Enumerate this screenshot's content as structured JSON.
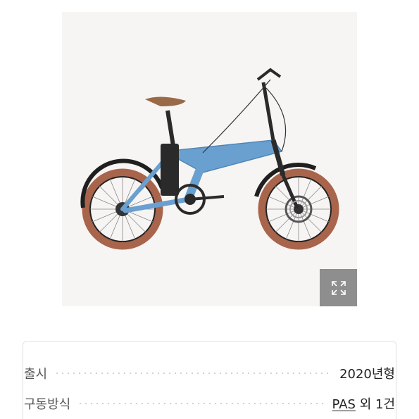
{
  "product": {
    "image_alt": "folding electric bicycle, light blue frame, brown tires",
    "frame_color": "#6aa0cf",
    "tire_color": "#a8654c"
  },
  "expand_icon": "expand-icon",
  "specs": [
    {
      "label": "출시",
      "value": "2020년형"
    },
    {
      "label": "구동방식",
      "value_link": "PAS",
      "value_rest": " 외 1건"
    }
  ]
}
